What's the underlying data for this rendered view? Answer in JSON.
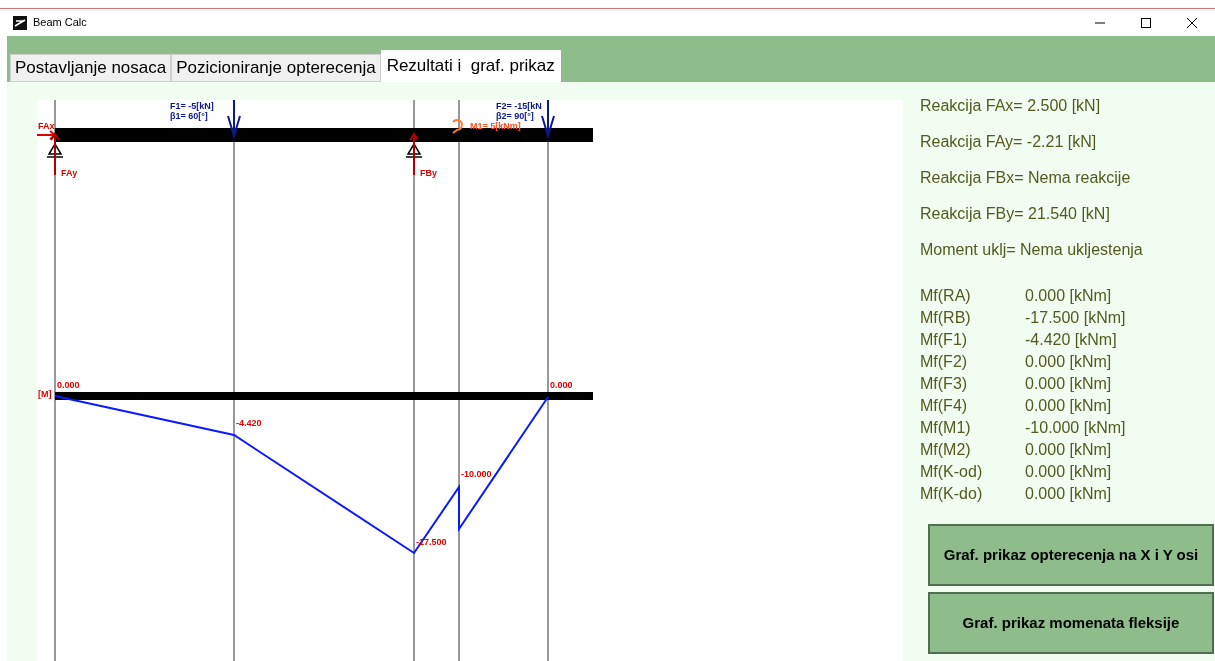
{
  "window": {
    "title": "Beam Calc"
  },
  "tabs": [
    {
      "label": "Postavljanje nosaca",
      "selected": false
    },
    {
      "label": "Pozicioniranje opterecenja",
      "selected": false
    },
    {
      "label": "Rezultati i  graf. prikaz",
      "selected": true
    }
  ],
  "beam_diagram": {
    "reaction_labels": [
      "FAx",
      "FAy",
      "FBy"
    ],
    "loads": [
      {
        "kind": "force",
        "lines": [
          "F1= -5[kN]",
          "β1= 60[°]"
        ]
      },
      {
        "kind": "moment",
        "lines": [
          "M1= 5[kNm]"
        ]
      },
      {
        "kind": "force",
        "lines": [
          "F2= -15[kN",
          "β2= 90[°]"
        ]
      }
    ]
  },
  "moment_diagram": {
    "axis_label": "[M]",
    "values": [
      "0.000",
      "-4.420",
      "-17.500",
      "-10.000",
      "0.000"
    ]
  },
  "reactions": [
    "Reakcija FAx= 2.500 [kN]",
    "Reakcija FAy= -2.21 [kN]",
    "Reakcija FBx= Nema reakcije",
    "Reakcija FBy= 21.540 [kN]",
    "Moment uklj= Nema ukljestenja"
  ],
  "moments": [
    {
      "name": "Mf(RA)",
      "value": "0.000 [kNm]"
    },
    {
      "name": "Mf(RB)",
      "value": "-17.500 [kNm]"
    },
    {
      "name": "Mf(F1)",
      "value": "-4.420 [kNm]"
    },
    {
      "name": "Mf(F2)",
      "value": "0.000 [kNm]"
    },
    {
      "name": "Mf(F3)",
      "value": "0.000 [kNm]"
    },
    {
      "name": "Mf(F4)",
      "value": "0.000 [kNm]"
    },
    {
      "name": "Mf(M1)",
      "value": "-10.000 [kNm]"
    },
    {
      "name": "Mf(M2)",
      "value": "0.000 [kNm]"
    },
    {
      "name": "Mf(K-od)",
      "value": "0.000 [kNm]"
    },
    {
      "name": "Mf(K-do)",
      "value": "0.000 [kNm]"
    }
  ],
  "buttons": [
    "Graf. prikaz opterecenja na X i Y osi",
    "Graf. prikaz momenata fleksije"
  ]
}
